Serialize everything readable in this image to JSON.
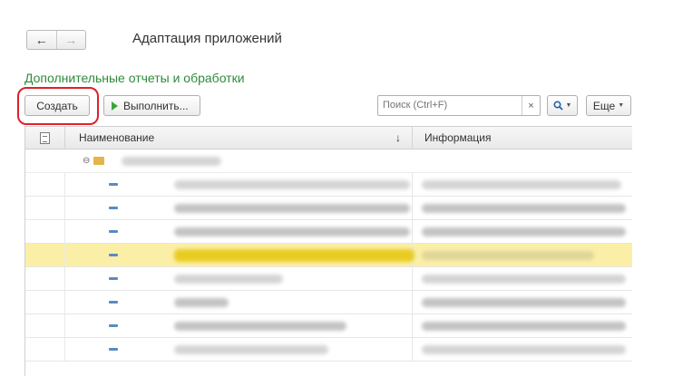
{
  "window": {
    "title": "Адаптация приложений"
  },
  "nav": {
    "back": "←",
    "forward": "→"
  },
  "form": {
    "title": "Дополнительные отчеты и обработки"
  },
  "toolbar": {
    "create_label": "Создать",
    "run_label": "Выполнить...",
    "search_placeholder": "Поиск (Ctrl+F)",
    "clear_label": "×",
    "more_label": "Еще"
  },
  "table": {
    "columns": [
      {
        "label": ""
      },
      {
        "label": "Наименование",
        "sort": "↓"
      },
      {
        "label": "Информация"
      }
    ],
    "rows": [
      {
        "type": "group",
        "expanded": true
      },
      {
        "type": "item",
        "selected": false
      },
      {
        "type": "item",
        "selected": false
      },
      {
        "type": "item",
        "selected": false
      },
      {
        "type": "item",
        "selected": true
      },
      {
        "type": "item",
        "selected": false
      },
      {
        "type": "item",
        "selected": false
      },
      {
        "type": "item",
        "selected": false
      },
      {
        "type": "item",
        "selected": false
      }
    ]
  },
  "colors": {
    "form_title": "#2e8b3a",
    "highlight_circle": "#e0202a",
    "selected_row": "#fbefa8",
    "run_icon": "#3aa43a"
  }
}
